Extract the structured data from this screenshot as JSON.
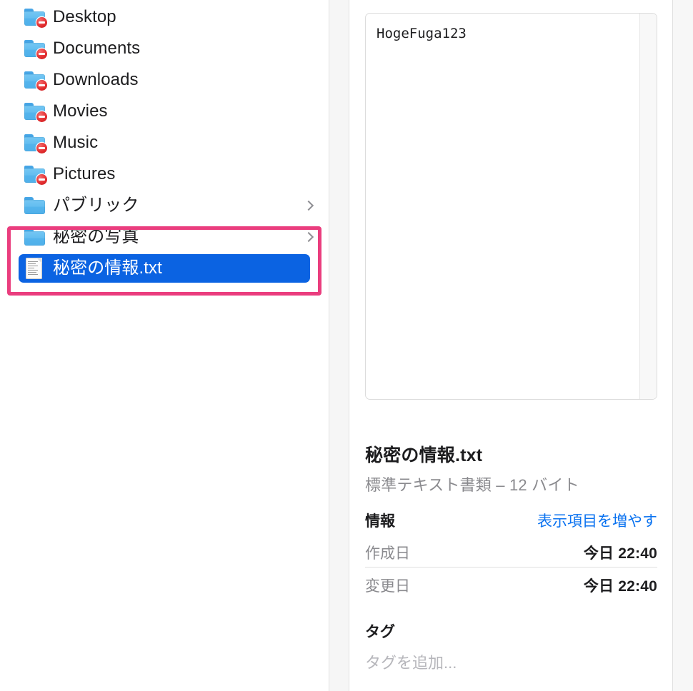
{
  "file_list": {
    "items": [
      {
        "label": "Desktop",
        "icon": "folder-icon",
        "restricted": true,
        "has_chevron": false,
        "selected": false
      },
      {
        "label": "Documents",
        "icon": "folder-icon",
        "restricted": true,
        "has_chevron": false,
        "selected": false
      },
      {
        "label": "Downloads",
        "icon": "folder-icon",
        "restricted": true,
        "has_chevron": false,
        "selected": false
      },
      {
        "label": "Movies",
        "icon": "folder-icon",
        "restricted": true,
        "has_chevron": false,
        "selected": false
      },
      {
        "label": "Music",
        "icon": "folder-icon",
        "restricted": true,
        "has_chevron": false,
        "selected": false
      },
      {
        "label": "Pictures",
        "icon": "folder-icon",
        "restricted": true,
        "has_chevron": false,
        "selected": false
      },
      {
        "label": "パブリック",
        "icon": "folder-icon",
        "restricted": false,
        "has_chevron": true,
        "selected": false
      },
      {
        "label": "秘密の写真",
        "icon": "folder-icon",
        "restricted": false,
        "has_chevron": true,
        "selected": false
      },
      {
        "label": "秘密の情報.txt",
        "icon": "document-icon",
        "restricted": false,
        "has_chevron": false,
        "selected": true
      }
    ]
  },
  "annotation": {
    "color": "#ea3d7e",
    "covers": [
      "秘密の写真",
      "秘密の情報.txt"
    ]
  },
  "colors": {
    "selection_blue": "#0b63e2",
    "link_blue": "#0a72f0",
    "annotation_pink": "#ea3d7e",
    "folder_blue": "#63bdf0",
    "deny_badge_red": "#e22c2e"
  },
  "inspector": {
    "preview": {
      "content": "HogeFuga123"
    },
    "file_name": "秘密の情報.txt",
    "file_kind_size": "標準テキスト書類 – 12 バイト",
    "info_section": {
      "title": "情報",
      "action_label": "表示項目を増やす",
      "rows": [
        {
          "key": "作成日",
          "value": "今日 22:40"
        },
        {
          "key": "変更日",
          "value": "今日 22:40"
        }
      ]
    },
    "tags_section": {
      "title": "タグ",
      "placeholder": "タグを追加..."
    }
  }
}
